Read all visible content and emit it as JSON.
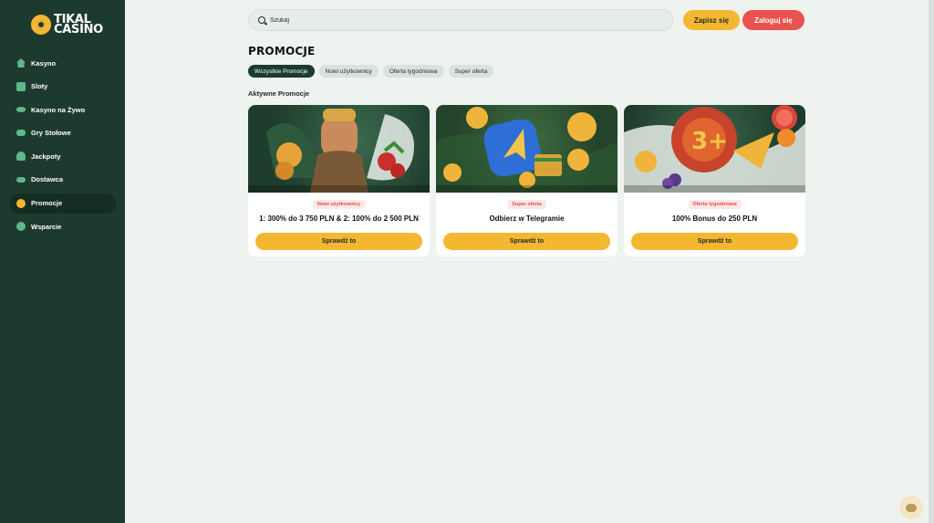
{
  "brand": {
    "logo_line1": "TIKAL",
    "logo_line2": "CASINO"
  },
  "sidebar": {
    "items": [
      {
        "label": "Kasyno",
        "icon": "home-icon"
      },
      {
        "label": "Sloty",
        "icon": "slots-icon"
      },
      {
        "label": "Kasyno na Żywo",
        "icon": "live-casino-icon"
      },
      {
        "label": "Gry Stołowe",
        "icon": "table-games-icon"
      },
      {
        "label": "Jackpoty",
        "icon": "jackpot-icon"
      },
      {
        "label": "Dostawca",
        "icon": "provider-icon"
      },
      {
        "label": "Promocje",
        "icon": "promotions-icon",
        "active": true
      },
      {
        "label": "Wsparcie",
        "icon": "support-icon"
      }
    ]
  },
  "header": {
    "search_placeholder": "Szukaj",
    "register_label": "Zapisz się",
    "login_label": "Zaloguj się"
  },
  "main": {
    "title": "PROMOCJE",
    "filters": [
      "Wszystkie Promocje",
      "Nowi użytkownicy",
      "Oferta tygodniowa",
      "Super oferta"
    ],
    "active_filter": "Wszystkie Promocje",
    "section_title": "Aktywne Promocje",
    "promos": [
      {
        "badge": "Nowi użytkownicy",
        "title": "1: 300% do 3 750 PLN & 2: 100% do 2 500 PLN",
        "button": "Sprawdź to"
      },
      {
        "badge": "Super oferta",
        "title": "Odbierz w Telegramie",
        "button": "Sprawdź to"
      },
      {
        "badge": "Oferta tygodniowa",
        "title": "100% Bonus do 250 PLN",
        "button": "Sprawdź to"
      }
    ]
  },
  "colors": {
    "sidebar_bg": "#1d3a2f",
    "accent_yellow": "#f4b731",
    "login_red": "#e9524f",
    "badge_red": "#e04e4b",
    "page_bg": "#eef3f0"
  },
  "chat": {
    "icon": "chat-bubble-icon"
  }
}
